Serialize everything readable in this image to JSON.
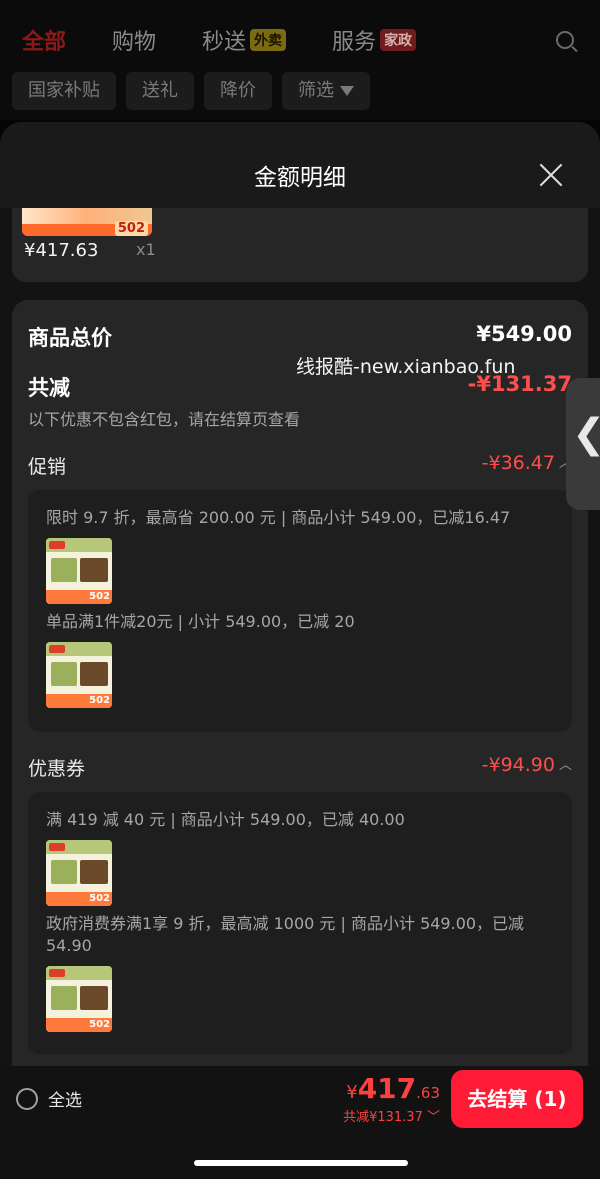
{
  "nav": {
    "tabs": [
      {
        "label": "全部",
        "badge": ""
      },
      {
        "label": "购物",
        "badge": ""
      },
      {
        "label": "秒送",
        "badge": "外卖"
      },
      {
        "label": "服务",
        "badge": "家政"
      }
    ],
    "filters": [
      "国家补贴",
      "送礼",
      "降价",
      "筛选"
    ]
  },
  "sheet": {
    "title": "金额明细",
    "product": {
      "price": "¥417.63",
      "qty": "x1",
      "tag": "502"
    }
  },
  "details": {
    "goods_total_label": "商品总价",
    "goods_total_value": "¥549.00",
    "total_discount_label": "共减",
    "total_discount_value": "-¥131.37",
    "note": "以下优惠不包含红包，请在结算页查看",
    "promotion": {
      "label": "促销",
      "value": "-¥36.47",
      "items": [
        "限时 9.7 折，最高省 200.00 元 | 商品小计 549.00，已减16.47",
        "单品满1件减20元 | 小计 549.00，已减 20"
      ]
    },
    "coupon": {
      "label": "优惠券",
      "value": "-¥94.90",
      "items": [
        "满 419 减 40 元 | 商品小计 549.00，已减 40.00",
        "政府消费券满1享 9 折，最高减 1000 元 | 商品小计 549.00，已减 54.90"
      ]
    },
    "thumb_tag": "502"
  },
  "watermark": "线报酷-new.xianbao.fun",
  "bottom": {
    "select_all": "全选",
    "total_yen": "¥",
    "total_int": "417",
    "total_dec": ".63",
    "saved": "共减¥131.37",
    "checkout": "去结算 (1)"
  },
  "colors": {
    "accent": "#ff1a36",
    "discount": "#ff4d4d"
  }
}
